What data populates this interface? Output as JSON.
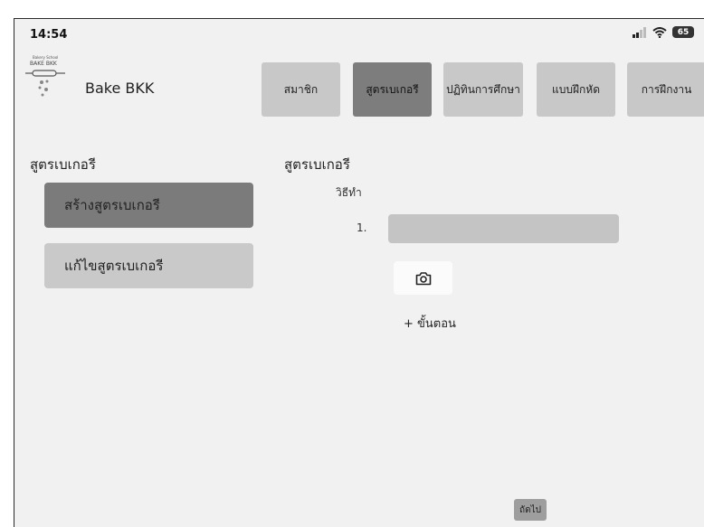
{
  "status_bar": {
    "time": "14:54",
    "battery": "65"
  },
  "brand": {
    "name": "Bake BKK",
    "logo_text": "BAKE BKK"
  },
  "tabs": [
    {
      "label": "สมาชิก",
      "active": false
    },
    {
      "label": "สูตรเบเกอรี",
      "active": true
    },
    {
      "label": "ปฏิทินการศึกษา",
      "active": false
    },
    {
      "label": "แบบฝึกหัด",
      "active": false
    },
    {
      "label": "การฝึกงาน",
      "active": false
    }
  ],
  "sidebar": {
    "title": "สูตรเบเกอรี",
    "items": [
      {
        "label": "สร้างสูตรเบเกอรี",
        "active": true
      },
      {
        "label": "แก้ไขสูตรเบเกอรี",
        "active": false
      }
    ]
  },
  "main": {
    "title": "สูตรเบเกอรี",
    "method_label": "วิธีทำ",
    "step_number": "1.",
    "step_value": "",
    "camera_icon": "camera-icon",
    "add_step_label": "+ ขั้นตอน",
    "next_label": "ถัดไป"
  },
  "colors": {
    "active_tab": "#7d7d7d",
    "inactive_tab": "#c8c8c8",
    "background": "#f1f1f1"
  }
}
